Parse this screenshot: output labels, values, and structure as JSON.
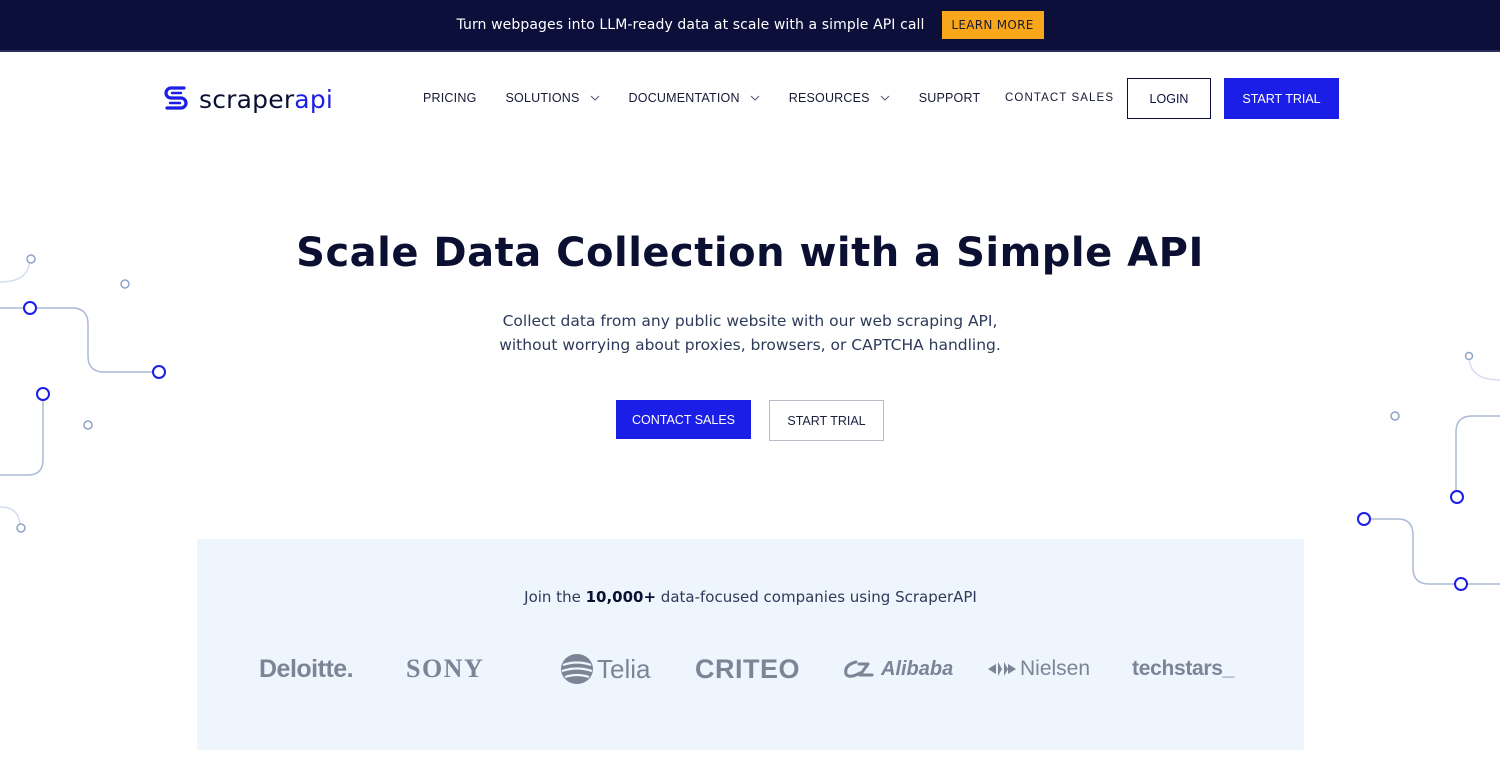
{
  "announcement": {
    "text": "Turn webpages into LLM-ready data at scale with a simple API call",
    "button_label": "LEARN MORE"
  },
  "nav": {
    "logo": {
      "part1": "scraper",
      "part2": "api"
    },
    "menu": [
      {
        "label": "PRICING",
        "has_dropdown": false
      },
      {
        "label": "SOLUTIONS",
        "has_dropdown": true
      },
      {
        "label": "DOCUMENTATION",
        "has_dropdown": true
      },
      {
        "label": "RESOURCES",
        "has_dropdown": true
      },
      {
        "label": "SUPPORT",
        "has_dropdown": false
      }
    ],
    "contact_sales": "CONTACT SALES",
    "login": "LOGIN",
    "start_trial": "START TRIAL"
  },
  "hero": {
    "title": "Scale Data Collection with a Simple API",
    "subtitle_line1": "Collect data from any public website with our web scraping API,",
    "subtitle_line2": "without worrying about proxies, browsers, or CAPTCHA handling.",
    "cta_primary": "CONTACT SALES",
    "cta_secondary": "START TRIAL"
  },
  "social_proof": {
    "text_before": "Join the ",
    "count": "10,000+",
    "text_after": " data-focused companies using ScraperAPI",
    "brands": [
      "Deloitte.",
      "SONY",
      "Telia",
      "CRITEO",
      "Alibaba",
      "Nielsen",
      "techstars_"
    ]
  },
  "colors": {
    "brand_blue": "#1b1ee6",
    "navy": "#0c0f3a",
    "accent_orange": "#f9a71a",
    "band_bg": "#eef5fd",
    "logo_gray": "#7d8496"
  }
}
